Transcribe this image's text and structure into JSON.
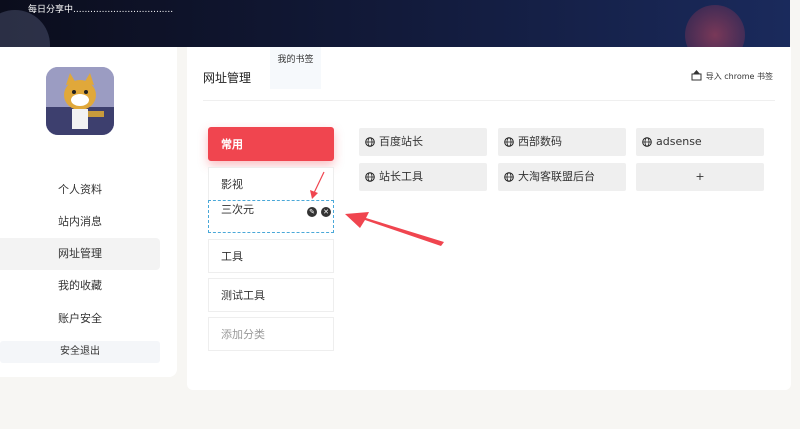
{
  "header": {
    "title": "每日分享中..................................."
  },
  "sidebar": {
    "items": [
      {
        "label": "个人资料"
      },
      {
        "label": "站内消息"
      },
      {
        "label": "网址管理"
      },
      {
        "label": "我的收藏"
      },
      {
        "label": "账户安全"
      }
    ],
    "logout_label": "安全退出"
  },
  "main": {
    "title": "网址管理",
    "tab_label": "我的书签",
    "import_label": "导入 chrome 书签",
    "categories": [
      {
        "label": "常用"
      },
      {
        "label": "影视"
      },
      {
        "label": "三次元"
      },
      {
        "label": "工具"
      },
      {
        "label": "测试工具"
      },
      {
        "label": "添加分类"
      }
    ],
    "sites": [
      {
        "label": "百度站长"
      },
      {
        "label": "西部数码"
      },
      {
        "label": "adsense"
      },
      {
        "label": "站长工具"
      },
      {
        "label": "大淘客联盟后台"
      },
      {
        "label": "+"
      }
    ]
  },
  "colors": {
    "accent": "#f0454f",
    "edit_border": "#4aa8d8",
    "arrow": "#f0454f"
  }
}
